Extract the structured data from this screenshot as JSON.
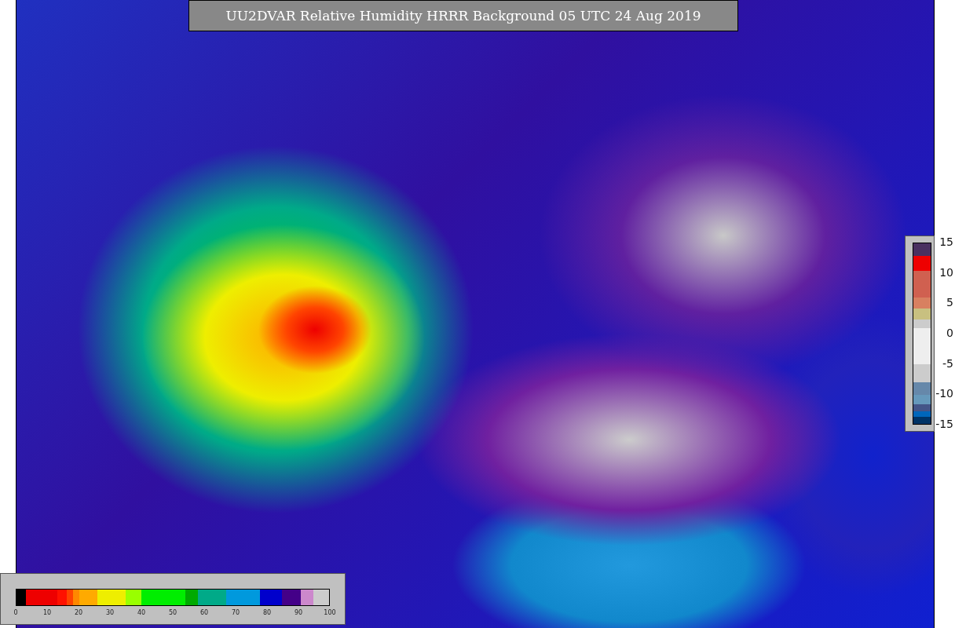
{
  "title": "UU2DVAR Relative Humidity HRRR Background  05 UTC 24 Aug 2019",
  "difference_scale": {
    "labels": [
      "15",
      "10",
      "5",
      "0",
      "-5",
      "-10",
      "-15"
    ]
  },
  "humidity_scale": {
    "labels": [
      "0",
      "10",
      "20",
      "30",
      "40",
      "50",
      "60",
      "70",
      "80",
      "90",
      "100"
    ]
  }
}
